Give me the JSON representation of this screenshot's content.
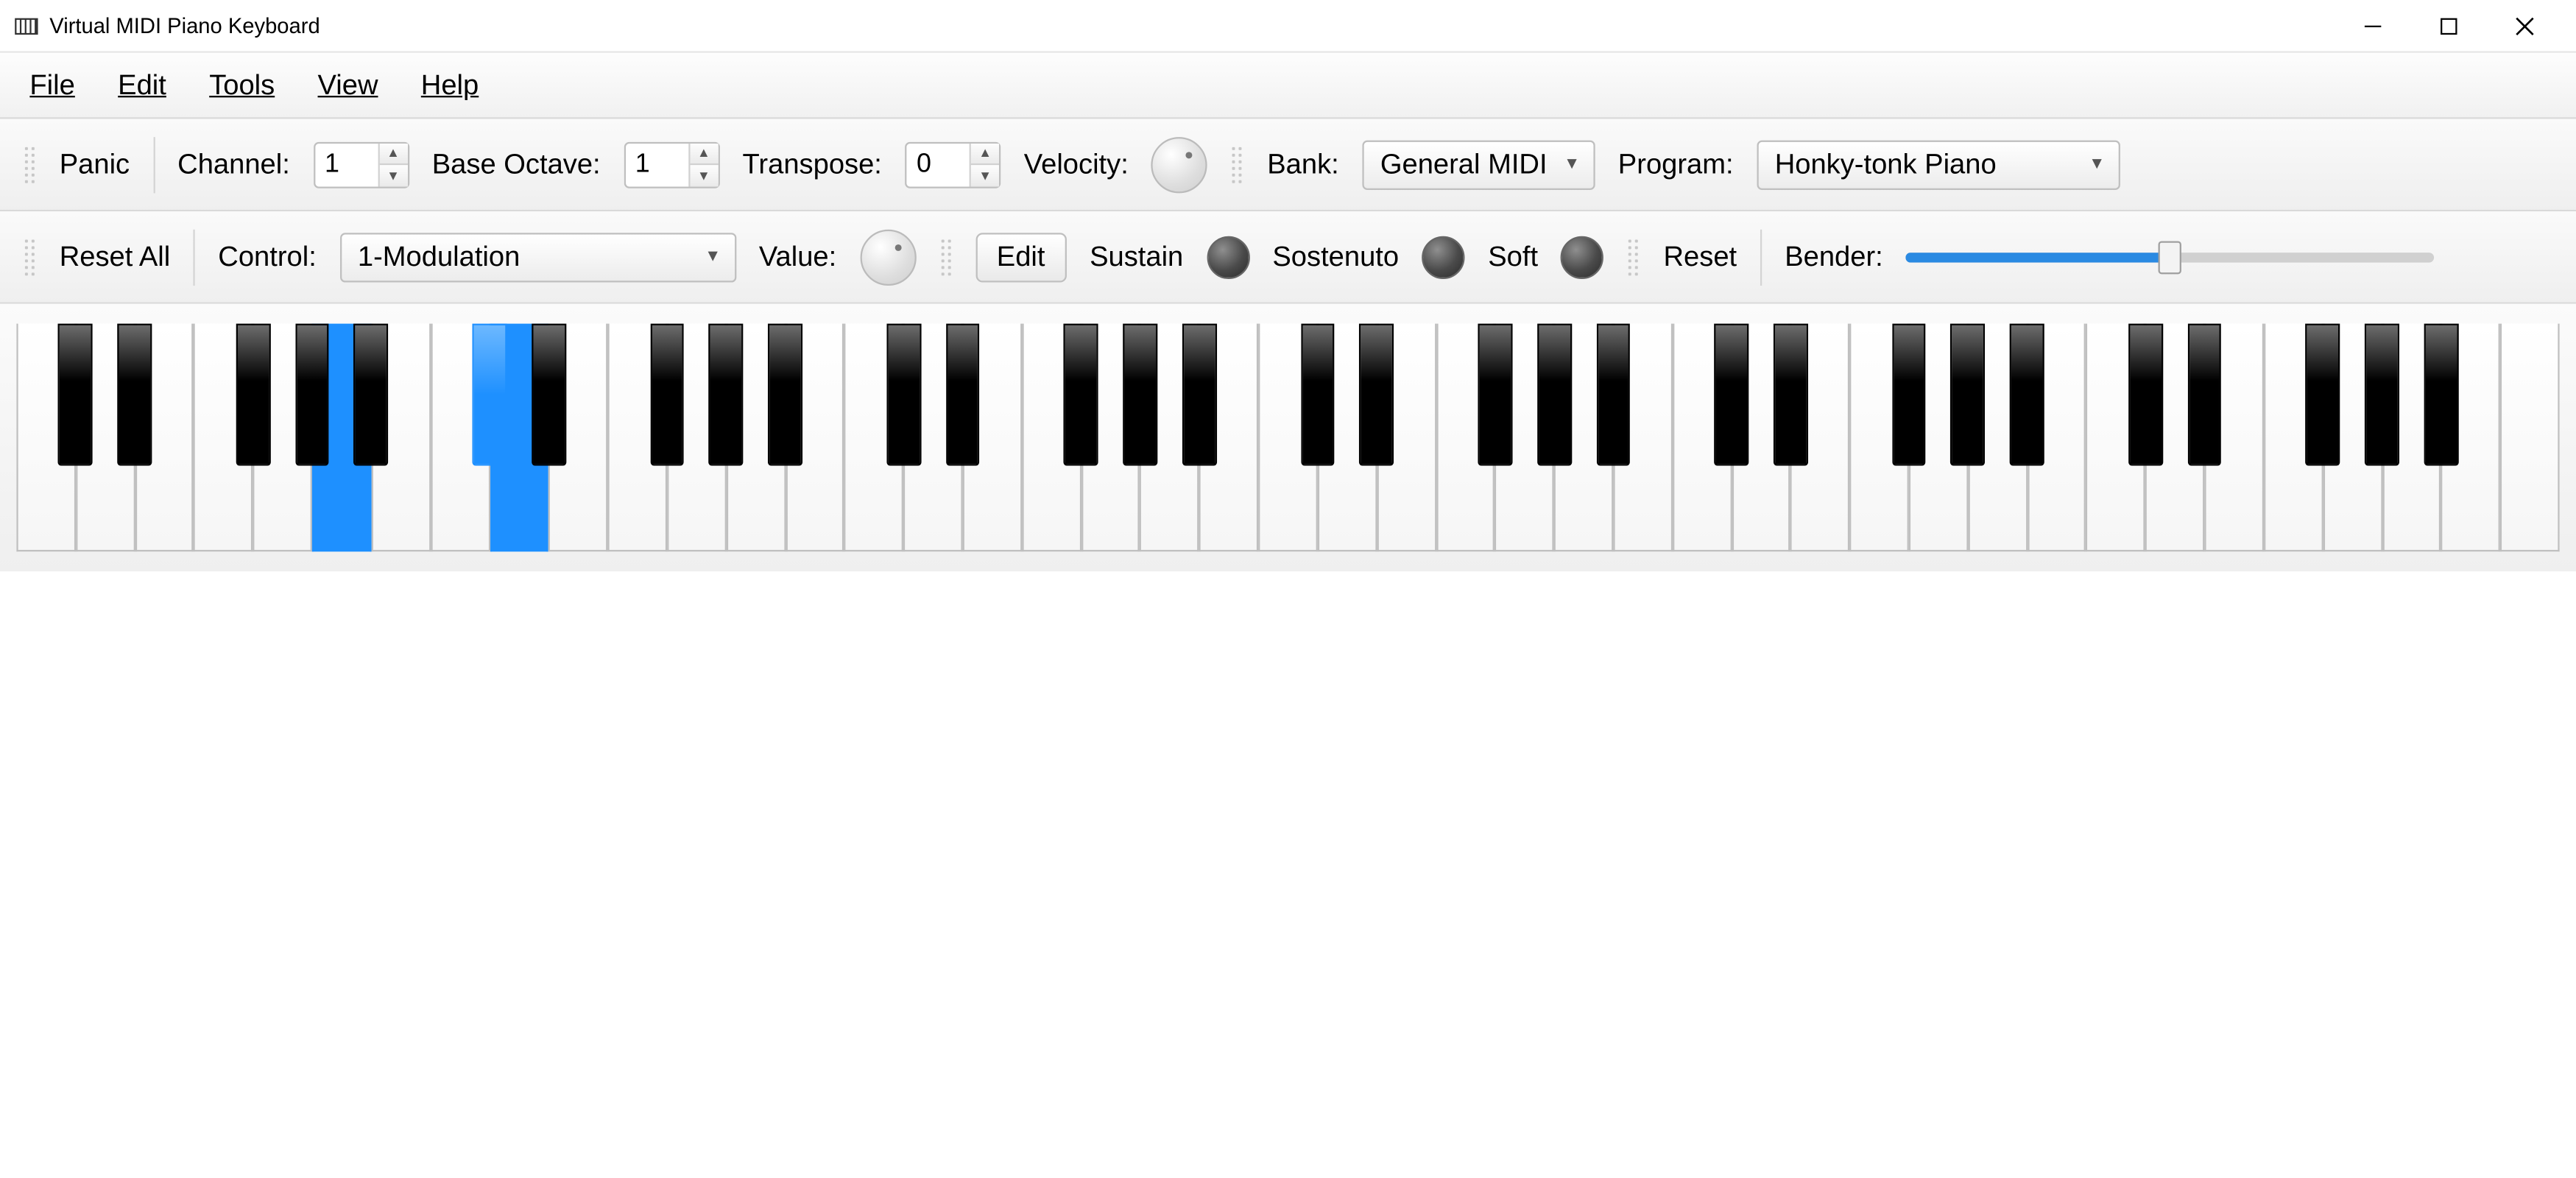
{
  "window": {
    "title": "Virtual MIDI Piano Keyboard"
  },
  "menu": {
    "file": {
      "label": "File",
      "hotkey_index": 0
    },
    "edit": {
      "label": "Edit",
      "hotkey_index": 0
    },
    "tools": {
      "label": "Tools",
      "hotkey_index": 0
    },
    "view": {
      "label": "View",
      "hotkey_index": 0
    },
    "help": {
      "label": "Help",
      "hotkey_index": 0
    }
  },
  "toolbar1": {
    "panic": "Panic",
    "channel_label": "Channel:",
    "channel_value": "1",
    "base_octave_label": "Base Octave:",
    "base_octave_value": "1",
    "transpose_label": "Transpose:",
    "transpose_value": "0",
    "velocity_label": "Velocity:",
    "bank_label": "Bank:",
    "bank_value": "General MIDI",
    "program_label": "Program:",
    "program_value": "Honky-tonk Piano"
  },
  "toolbar2": {
    "reset_all": "Reset All",
    "control_label": "Control:",
    "control_value": "1-Modulation",
    "value_label": "Value:",
    "edit": "Edit",
    "sustain": "Sustain",
    "sostenuto": "Sostenuto",
    "soft": "Soft",
    "reset": "Reset",
    "bender_label": "Bender:",
    "bender_value": 50
  },
  "piano": {
    "white_key_count": 43,
    "black_pattern": [
      true,
      true,
      false,
      true,
      true,
      true,
      false
    ],
    "pressed_white_indices": [
      5,
      8
    ],
    "pressed_black_after_white": [
      7
    ]
  }
}
